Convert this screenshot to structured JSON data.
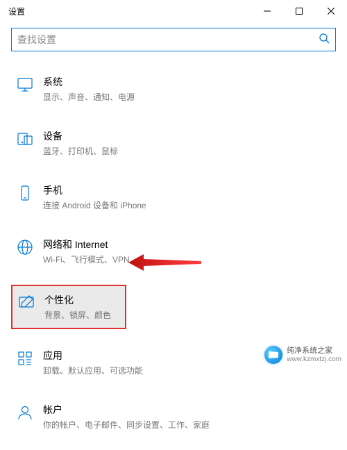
{
  "window": {
    "title": "设置"
  },
  "search": {
    "placeholder": "查找设置"
  },
  "categories": [
    {
      "id": "system",
      "title": "系统",
      "desc": "显示、声音、通知、电源"
    },
    {
      "id": "devices",
      "title": "设备",
      "desc": "蓝牙、打印机、鼠标"
    },
    {
      "id": "phone",
      "title": "手机",
      "desc": "连接 Android 设备和 iPhone"
    },
    {
      "id": "network",
      "title": "网络和 Internet",
      "desc": "Wi-Fi、飞行模式、VPN"
    },
    {
      "id": "personalization",
      "title": "个性化",
      "desc": "背景、锁屏、颜色"
    },
    {
      "id": "apps",
      "title": "应用",
      "desc": "卸载、默认应用、可选功能"
    },
    {
      "id": "accounts",
      "title": "帐户",
      "desc": "你的帐户、电子邮件、同步设置、工作、家庭"
    }
  ],
  "watermark": {
    "name": "纯净系统之家",
    "url": "www.kzmxtzj.com"
  }
}
